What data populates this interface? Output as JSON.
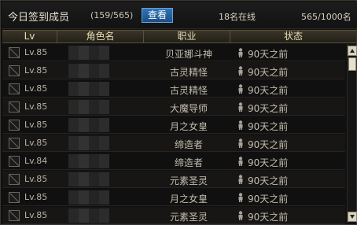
{
  "header": {
    "title": "今日签到成员",
    "count": "(159/565)",
    "view_button": "查看",
    "online": "18名在线",
    "capacity": "565/1000名"
  },
  "columns": {
    "level": "Lv",
    "name": "角色名",
    "job": "职业",
    "status": "状态"
  },
  "rows": [
    {
      "level": "Lv.85",
      "job": "贝亚娜斗神",
      "status": "90天之前"
    },
    {
      "level": "Lv.85",
      "job": "古灵精怪",
      "status": "90天之前"
    },
    {
      "level": "Lv.85",
      "job": "古灵精怪",
      "status": "90天之前"
    },
    {
      "level": "Lv.85",
      "job": "大魔导师",
      "status": "90天之前"
    },
    {
      "level": "Lv.85",
      "job": "月之女皇",
      "status": "90天之前"
    },
    {
      "level": "Lv.85",
      "job": "缔造者",
      "status": "90天之前"
    },
    {
      "level": "Lv.84",
      "job": "缔造者",
      "status": "90天之前"
    },
    {
      "level": "Lv.85",
      "job": "元素圣灵",
      "status": "90天之前"
    },
    {
      "level": "Lv.85",
      "job": "月之女皇",
      "status": "90天之前"
    },
    {
      "level": "Lv.85",
      "job": "元素圣灵",
      "status": "90天之前"
    }
  ],
  "icons": {
    "checkbox": "checkbox-icon",
    "status": "person-icon",
    "scroll_up": "triangle-up-icon",
    "scroll_down": "triangle-down-icon"
  }
}
